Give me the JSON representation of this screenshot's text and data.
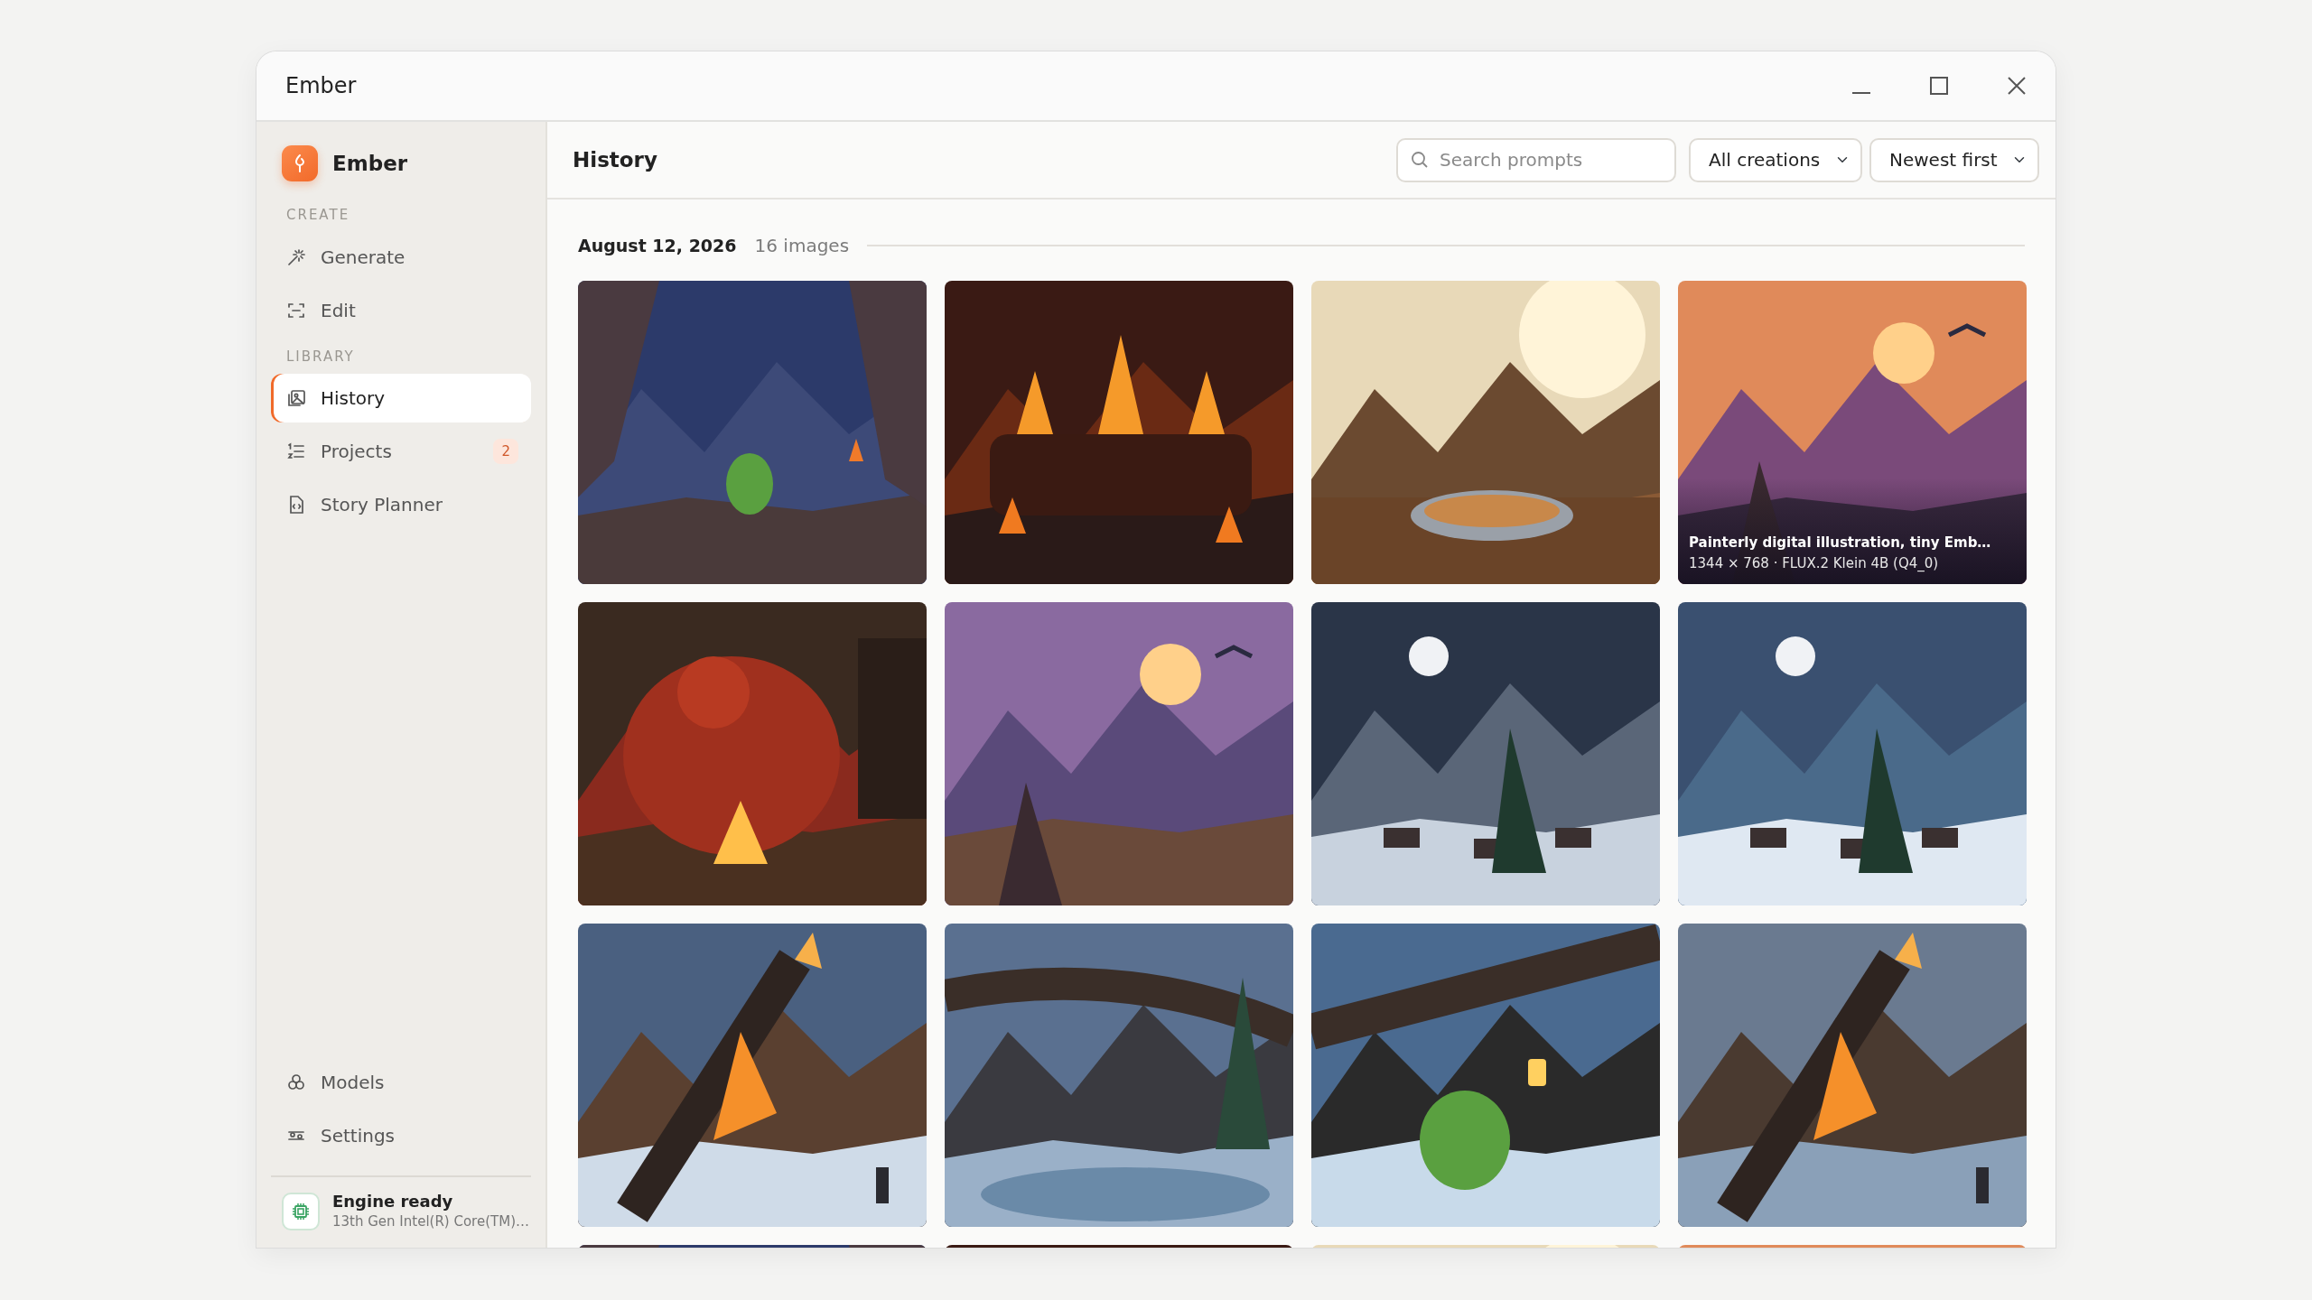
{
  "window": {
    "title": "Ember"
  },
  "sidebar": {
    "brand": "Ember",
    "sections": [
      {
        "label": "CREATE",
        "items": [
          {
            "label": "Generate",
            "selected": false
          },
          {
            "label": "Edit",
            "selected": false
          }
        ]
      },
      {
        "label": "LIBRARY",
        "items": [
          {
            "label": "History",
            "selected": true
          },
          {
            "label": "Projects",
            "selected": false,
            "badge": "2"
          },
          {
            "label": "Story Planner",
            "selected": false
          }
        ]
      }
    ],
    "bottom_items": [
      {
        "label": "Models",
        "selected": false
      },
      {
        "label": "Settings",
        "selected": false
      }
    ],
    "engine": {
      "status": "Engine ready",
      "device": "13th Gen Intel(R) Core(TM)…"
    }
  },
  "header": {
    "title": "History",
    "search": {
      "placeholder": "Search prompts"
    },
    "filters": [
      {
        "value": "All creations"
      },
      {
        "value": "Newest first"
      }
    ]
  },
  "groups": [
    {
      "date": "August 12, 2026",
      "count": "16 images",
      "images": [
        {
          "kind": "picture"
        },
        {
          "kind": "picture"
        },
        {
          "kind": "picture"
        },
        {
          "kind": "picture",
          "caption": {
            "title": "Painterly digital illustration, tiny Emb…",
            "meta": "1344 × 768 · FLUX.2 Klein 4B (Q4_0)"
          }
        },
        {
          "kind": "picture"
        },
        {
          "kind": "picture"
        },
        {
          "kind": "picture"
        },
        {
          "kind": "picture"
        },
        {
          "kind": "picture"
        },
        {
          "kind": "picture"
        },
        {
          "kind": "picture"
        },
        {
          "kind": "picture"
        },
        {
          "kind": "picture"
        },
        {
          "kind": "picture"
        },
        {
          "kind": "picture"
        },
        {
          "kind": "picture"
        }
      ]
    }
  ]
}
